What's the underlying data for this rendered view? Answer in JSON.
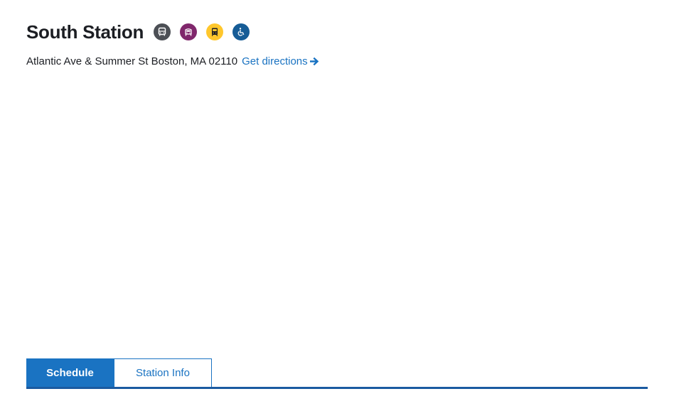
{
  "station": {
    "name": "South Station",
    "modes": [
      {
        "name": "bus",
        "icon": "bus-icon",
        "color": "#4c4f55"
      },
      {
        "name": "commuter-rail",
        "icon": "commuter-rail-icon",
        "color": "#80276c"
      },
      {
        "name": "subway",
        "icon": "subway-icon",
        "color": "#ffc72c"
      },
      {
        "name": "accessible",
        "icon": "wheelchair-icon",
        "color": "#165c96"
      }
    ],
    "address": "Atlantic Ave & Summer St Boston, MA 02110",
    "directions_label": "Get directions"
  },
  "tabs": [
    {
      "label": "Schedule",
      "active": true
    },
    {
      "label": "Station Info",
      "active": false
    }
  ],
  "colors": {
    "accent": "#1a73c2",
    "underline": "#1a5aa0"
  }
}
